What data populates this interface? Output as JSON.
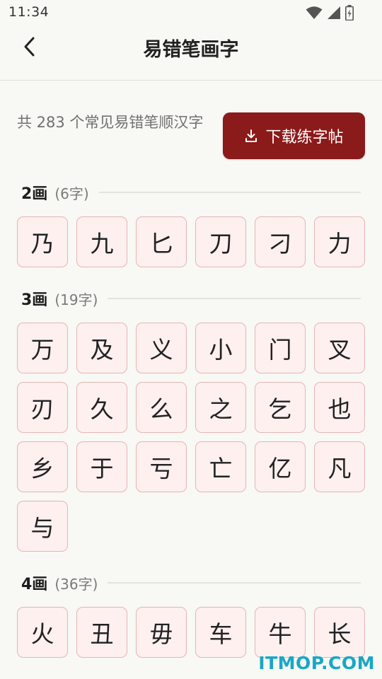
{
  "status_bar": {
    "time": "11:34",
    "icons": [
      "wifi-icon",
      "cell-signal-icon",
      "battery-charging-icon"
    ]
  },
  "header": {
    "back_icon": "chevron-left-icon",
    "title": "易错笔画字"
  },
  "intro": {
    "text": "共 283 个常见易错笔顺汉字",
    "download_label": "下载练字帖",
    "download_icon": "download-icon"
  },
  "sections": [
    {
      "title": "2画",
      "count": "(6字)",
      "chars": [
        "乃",
        "九",
        "匕",
        "刀",
        "刁",
        "力"
      ]
    },
    {
      "title": "3画",
      "count": "(19字)",
      "chars": [
        "万",
        "及",
        "义",
        "小",
        "门",
        "叉",
        "刃",
        "久",
        "么",
        "之",
        "乞",
        "也",
        "乡",
        "于",
        "亏",
        "亡",
        "亿",
        "凡",
        "与"
      ]
    },
    {
      "title": "4画",
      "count": "(36字)",
      "chars": [
        "火",
        "丑",
        "毋",
        "车",
        "牛",
        "长"
      ]
    }
  ],
  "colors": {
    "accent": "#8b1a1a",
    "tile_bg": "#fdf0ef",
    "tile_border": "#e6b5b5",
    "background": "#f8f8f4",
    "watermark": "#19a7c6"
  },
  "watermark": "ITMOP.COM"
}
